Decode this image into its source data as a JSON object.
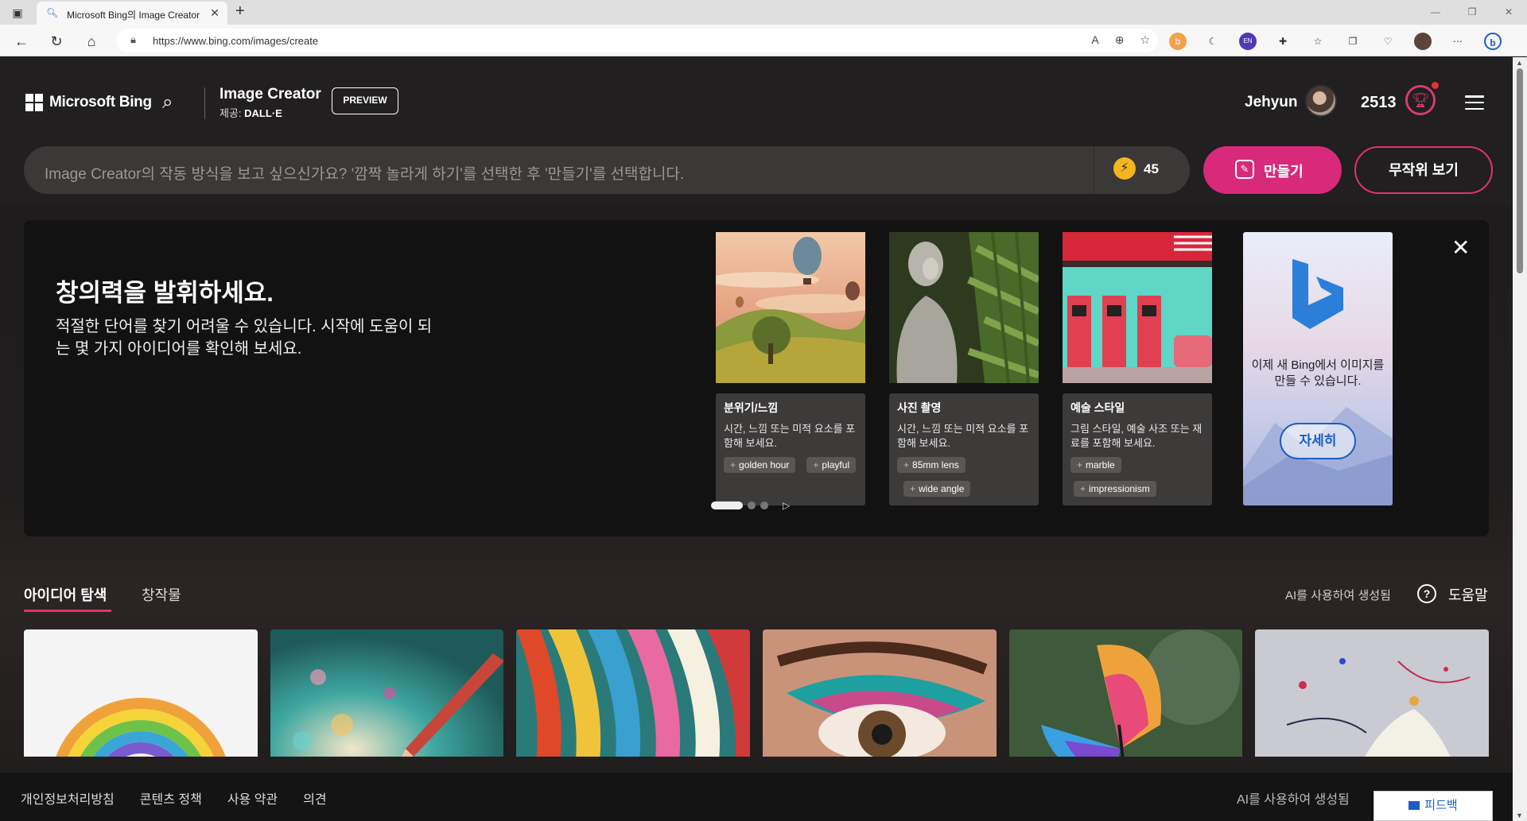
{
  "browser": {
    "tab_title": "Microsoft Bing의 Image Creator",
    "tab_close": "✕",
    "new_tab": "+",
    "url": "https://www.bing.com/images/create",
    "window_controls": [
      "—",
      "❐",
      "✕"
    ]
  },
  "header": {
    "brand": "Microsoft Bing",
    "product_title": "Image Creator",
    "product_sub_prefix": "제공: ",
    "product_sub_bold": "DALL·E",
    "preview_label": "PREVIEW",
    "user_name": "Jehyun",
    "points": "2513"
  },
  "prompt": {
    "placeholder": "Image Creator의 작동 방식을 보고 싶으신가요? '깜짝 놀라게 하기'를 선택한 후 '만들기'를 선택합니다.",
    "boosts": "45",
    "create_label": "만들기",
    "random_label": "무작위 보기"
  },
  "inspiration": {
    "heading": "창의력을 발휘하세요.",
    "description": "적절한 단어를 찾기 어려울 수 있습니다. 시작에 도움이 되는 몇 가지 아이디어를 확인해 보세요.",
    "cards": [
      {
        "title": "분위기/느낌",
        "desc": "시간, 느낌 또는 미적 요소를 포함해 보세요.",
        "chips": [
          "golden hour",
          "playful"
        ]
      },
      {
        "title": "사진 촬영",
        "desc": "시간, 느낌 또는 미적 요소를 포함해 보세요.",
        "chips": [
          "85mm lens",
          "wide angle"
        ]
      },
      {
        "title": "예술 스타일",
        "desc": "그림 스타일, 예술 사조 또는 재료를 포함해 보세요.",
        "chips": [
          "marble",
          "impressionism"
        ]
      }
    ],
    "bing_card_text": "이제 새 Bing에서 이미지를 만들 수 있습니다.",
    "bing_card_button": "자세히"
  },
  "tabs": {
    "explore": "아이디어 탐색",
    "creations": "창작물",
    "ai_note": "AI를 사용하여 생성됨",
    "help": "도움말"
  },
  "footer": {
    "links": [
      "개인정보처리방침",
      "콘텐츠 정책",
      "사용 약관",
      "의견"
    ],
    "ai_note": "AI를 사용하여 생성됨",
    "feedback": "피드백"
  },
  "colors": {
    "accent_pink": "#d8297a",
    "boost_gold": "#f3b521",
    "bing_blue": "#1a5ec7"
  }
}
